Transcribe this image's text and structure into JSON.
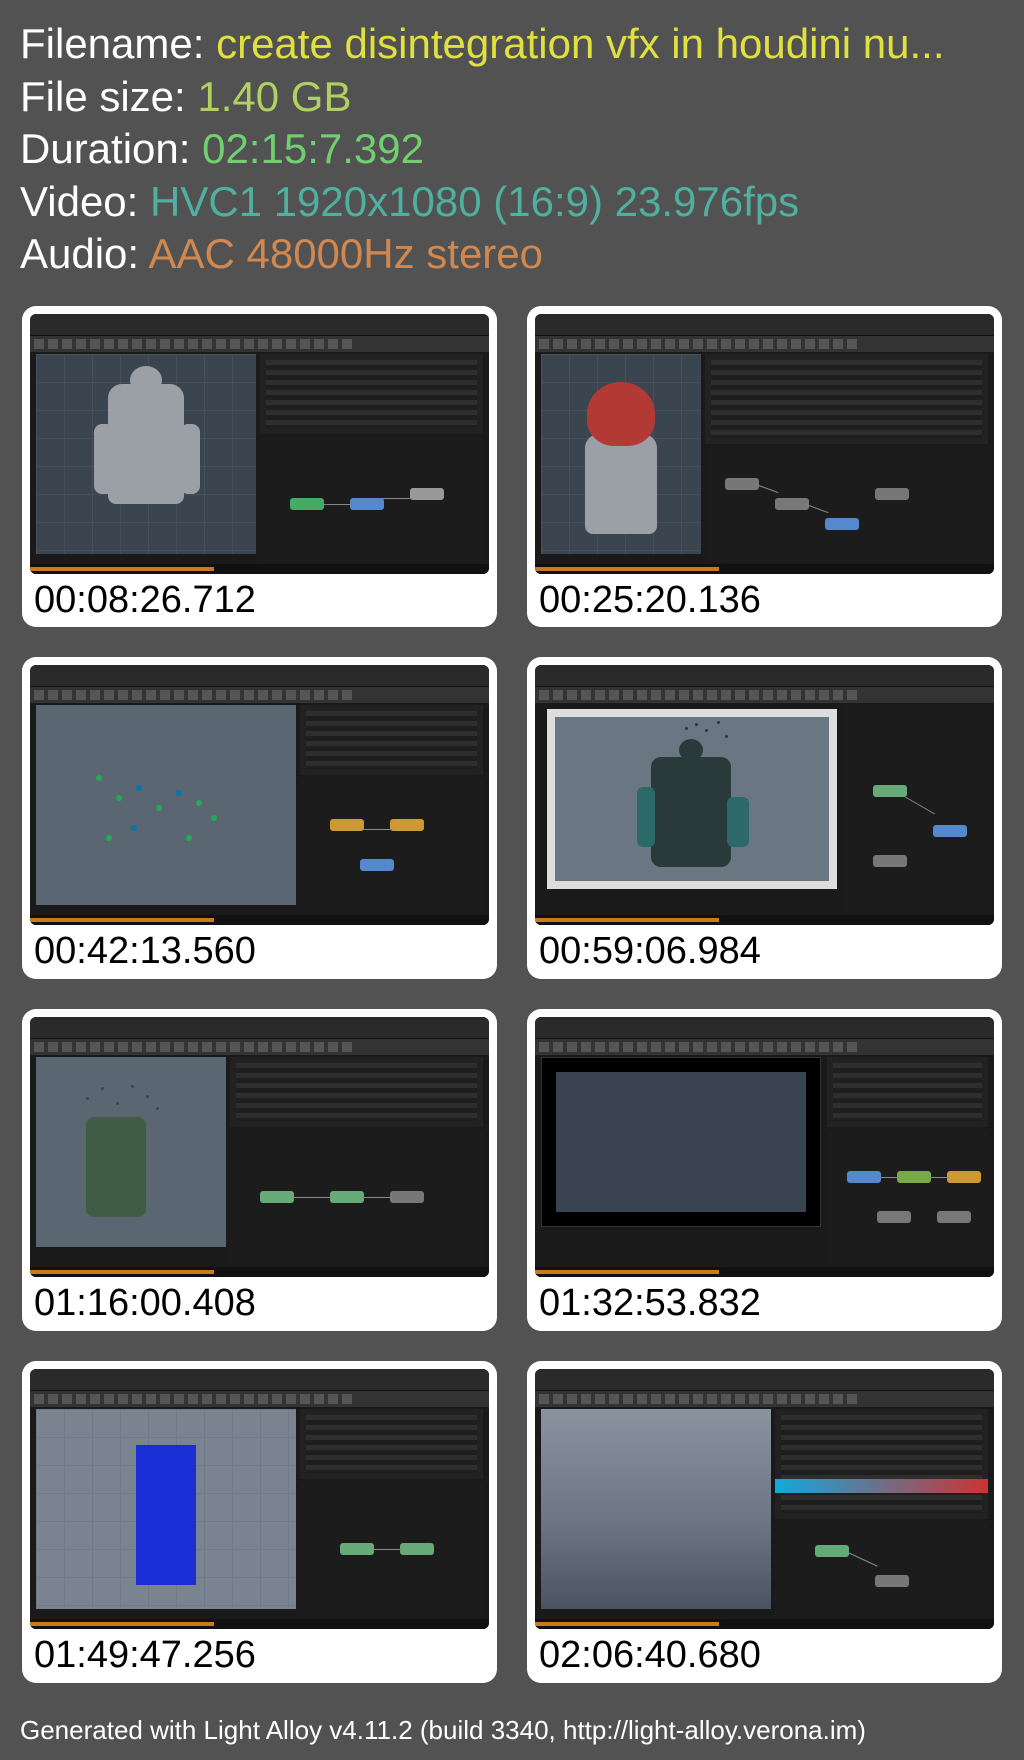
{
  "info": {
    "filename_label": "Filename: ",
    "filename_value": "create disintegration vfx in houdini nu...",
    "filesize_label": "File size: ",
    "filesize_value": "1.40 GB",
    "duration_label": "Duration: ",
    "duration_value": "02:15:7.392",
    "video_label": "Video: ",
    "video_value": "HVC1 1920x1080 (16:9) 23.976fps",
    "audio_label": "Audio: ",
    "audio_value": "AAC 48000Hz stereo"
  },
  "thumbs": [
    {
      "ts": "00:08:26.712"
    },
    {
      "ts": "00:25:20.136"
    },
    {
      "ts": "00:42:13.560"
    },
    {
      "ts": "00:59:06.984"
    },
    {
      "ts": "01:16:00.408"
    },
    {
      "ts": "01:32:53.832"
    },
    {
      "ts": "01:49:47.256"
    },
    {
      "ts": "02:06:40.680"
    }
  ],
  "footer": "Generated with Light Alloy v4.11.2 (build 3340, http://light-alloy.verona.im)"
}
